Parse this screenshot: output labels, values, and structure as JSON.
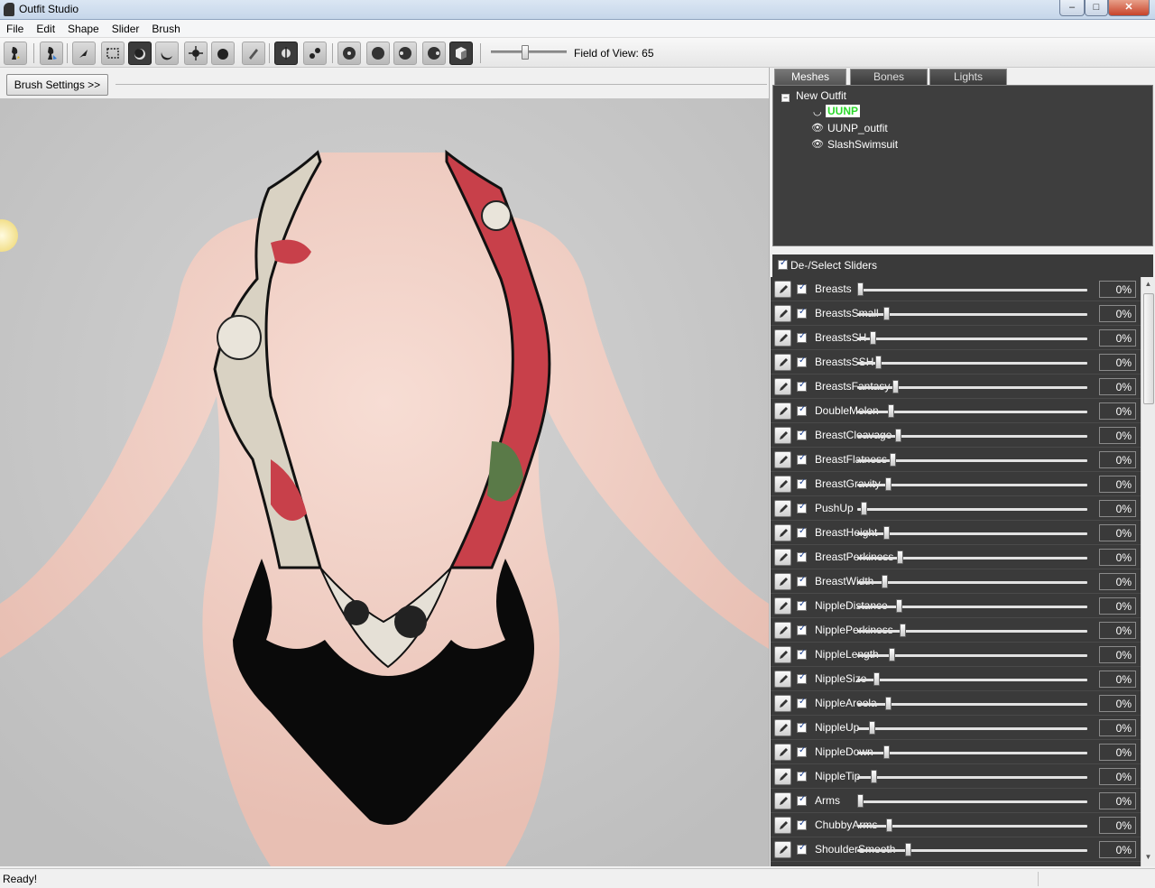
{
  "window": {
    "title": "Outfit Studio",
    "minimize": "–",
    "maximize": "□",
    "close": "✕"
  },
  "menu": [
    "File",
    "Edit",
    "Shape",
    "Slider",
    "Brush"
  ],
  "toolbar": {
    "icons": [
      "load-reference-icon",
      "load-outfit-icon",
      "select-brush-icon",
      "mask-brush-icon",
      "inflate-brush-icon",
      "deflate-brush-icon",
      "move-brush-icon",
      "smooth-brush-icon",
      "paint-weight-icon",
      "x-mirror-icon",
      "connected-only-icon",
      "front-view-icon",
      "back-view-icon",
      "left-view-icon",
      "right-view-icon",
      "perspective-icon"
    ],
    "fov_label": "Field of View: 65",
    "fov_value": 65
  },
  "brush_settings_label": "Brush Settings >>",
  "tabs": [
    "Meshes",
    "Bones",
    "Lights"
  ],
  "active_tab": "Meshes",
  "meshes": {
    "root": "New Outfit",
    "items": [
      {
        "name": "UUNP",
        "selected": true
      },
      {
        "name": "UUNP_outfit",
        "selected": false
      },
      {
        "name": "SlashSwimsuit",
        "selected": false
      }
    ]
  },
  "slider_header": "De-/Select Sliders",
  "sliders": [
    {
      "name": "Breasts",
      "value": "0%",
      "pos": 0.0
    },
    {
      "name": "BreastsSmall",
      "value": "0%",
      "pos": 0.117
    },
    {
      "name": "BreastsSH",
      "value": "0%",
      "pos": 0.055
    },
    {
      "name": "BreastsSSH",
      "value": "0%",
      "pos": 0.082
    },
    {
      "name": "BreastsFantasy",
      "value": "0%",
      "pos": 0.157
    },
    {
      "name": "DoubleMelon",
      "value": "0%",
      "pos": 0.137
    },
    {
      "name": "BreastCleavage",
      "value": "0%",
      "pos": 0.169
    },
    {
      "name": "BreastFlatness",
      "value": "0%",
      "pos": 0.145
    },
    {
      "name": "BreastGravity",
      "value": "0%",
      "pos": 0.125
    },
    {
      "name": "PushUp",
      "value": "0%",
      "pos": 0.016
    },
    {
      "name": "BreastHeight",
      "value": "0%",
      "pos": 0.118
    },
    {
      "name": "BreastPerkiness",
      "value": "0%",
      "pos": 0.176
    },
    {
      "name": "BreastWidth",
      "value": "0%",
      "pos": 0.11
    },
    {
      "name": "NippleDistance",
      "value": "0%",
      "pos": 0.173
    },
    {
      "name": "NipplePerkiness",
      "value": "0%",
      "pos": 0.188
    },
    {
      "name": "NippleLength",
      "value": "0%",
      "pos": 0.141
    },
    {
      "name": "NippleSize",
      "value": "0%",
      "pos": 0.071
    },
    {
      "name": "NippleAreola",
      "value": "0%",
      "pos": 0.125
    },
    {
      "name": "NippleUp",
      "value": "0%",
      "pos": 0.051
    },
    {
      "name": "NippleDown",
      "value": "0%",
      "pos": 0.115
    },
    {
      "name": "NippleTip",
      "value": "0%",
      "pos": 0.059
    },
    {
      "name": "Arms",
      "value": "0%",
      "pos": 0.0
    },
    {
      "name": "ChubbyArms",
      "value": "0%",
      "pos": 0.13
    },
    {
      "name": "ShoulderSmooth",
      "value": "0%",
      "pos": 0.212
    }
  ],
  "status": "Ready!"
}
